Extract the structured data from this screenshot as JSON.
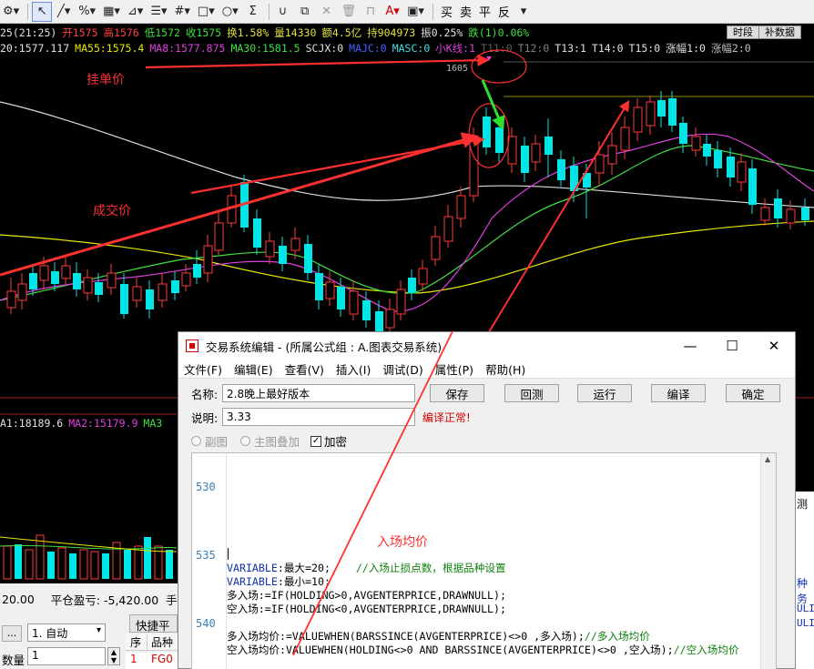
{
  "toolbar": {
    "trade_buy": "买",
    "trade_sell": "卖",
    "trade_flat": "平",
    "trade_reverse": "反"
  },
  "quote_row": {
    "time": "25(21:25)",
    "open": "开1575",
    "high": "高1576",
    "low": "低1572",
    "close": "收1575",
    "turnover_rate": "换1.58%",
    "volume": "量14330",
    "amount": "额4.5亿",
    "open_interest": "持904973",
    "amplitude": "振0.25%",
    "change": "跌(1)0.06%",
    "btn_period": "时段",
    "btn_fill": "补数据"
  },
  "ma_row": {
    "ma20": "20:1577.117",
    "ma55": "MA55:1575.4",
    "ma8": "MA8:1577.875",
    "ma30": "MA30:1581.5",
    "scjx": "SCJX:0",
    "majc": "MAJC:0",
    "masc": "MASC:0",
    "xiaok": "小K线:1",
    "t11": "T11:0",
    "t12": "T12:0",
    "t13": "T13:1",
    "t14": "T14:0",
    "t15": "T15:0",
    "zf1": "涨幅1:0",
    "zf2": "涨幅2:0"
  },
  "chart": {
    "price_label": "1605",
    "annotation_order_price": "挂单价",
    "annotation_fill_price": "成交价",
    "annotation_entry_avg": "入场均价"
  },
  "sub_indicator": {
    "ma1": "A1:18189.6",
    "ma2": "MA2:15179.9",
    "ma3": "MA3"
  },
  "dialog": {
    "title": "交易系统编辑 - (所属公式组 : A.图表交易系统)",
    "menu": [
      "文件(F)",
      "编辑(E)",
      "查看(V)",
      "插入(I)",
      "调试(D)",
      "属性(P)",
      "帮助(H)"
    ],
    "name_label": "名称:",
    "name_value": "2.8晚上最好版本",
    "desc_label": "说明:",
    "desc_value": "3.33",
    "compile_status": "编译正常!",
    "btn_save": "保存",
    "btn_backtest": "回测",
    "btn_run": "运行",
    "btn_compile": "编译",
    "btn_ok": "确定",
    "radio_sub": "副图",
    "radio_main": "主图叠加",
    "check_encrypt": "加密",
    "lines": [
      "530",
      "535",
      "540"
    ],
    "code": [
      {
        "kw": "VARIABLE",
        "text": ":最大=20;",
        "comment": "//入场止损点数，根据品种设置"
      },
      {
        "kw": "VARIABLE",
        "text": ":最小=10;",
        "comment": ""
      },
      {
        "kw": "",
        "text": "多入场:=IF(HOLDING>0,AVGENTERPRICE,DRAWNULL);",
        "comment": ""
      },
      {
        "kw": "",
        "text": "空入场:=IF(HOLDING<0,AVGENTERPRICE,DRAWNULL);",
        "comment": ""
      },
      {
        "kw": "",
        "text": "",
        "comment": ""
      },
      {
        "kw": "",
        "text": "多入场均价:=VALUEWHEN(BARSSINCE(AVGENTERPRICE)<>0 ,多入场);",
        "comment": "//多入场均价"
      },
      {
        "kw": "",
        "text": "空入场均价:VALUEWHEN(HOLDING<>0 AND BARSSINCE(AVGENTERPRICE)<>0 ,空入场);",
        "comment": "//空入场均价"
      }
    ]
  },
  "bottom": {
    "left_value": "20.00",
    "flat_pnl": "平仓盈亏: -5,420.00",
    "hand": "手",
    "mode_value": "1. 自动",
    "qty_label": "数量",
    "qty_value": "1",
    "quick_label": "快捷平",
    "col_seq": "序",
    "col_variety": "品种",
    "row_seq": "1",
    "row_variety": "FG0"
  },
  "right_panel": {
    "text_1": "测",
    "text_2": "种务",
    "text_3": "ULI",
    "text_4": "ULI"
  },
  "colors": {
    "up": "#ff3b3b",
    "down": "#00e5e5",
    "ma_yellow": "#e8e800",
    "ma_magenta": "#e040e0",
    "ma_green": "#40e040",
    "ma_white": "#e0e0e0",
    "annotation_red": "#ff3030"
  }
}
